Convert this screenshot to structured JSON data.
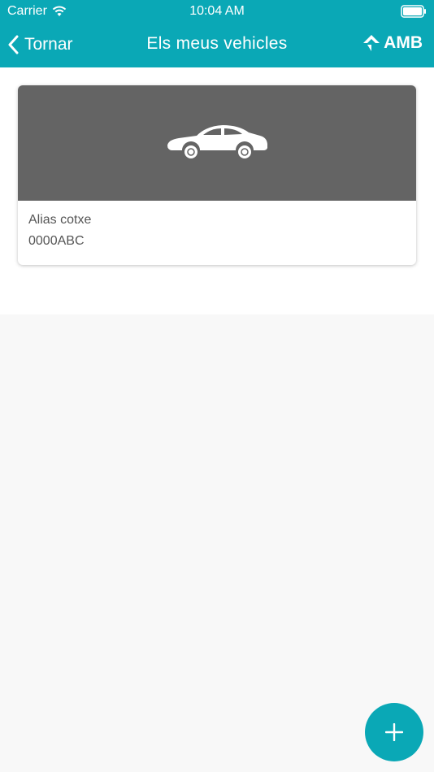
{
  "status_bar": {
    "carrier": "Carrier",
    "time": "10:04 AM"
  },
  "nav": {
    "back_label": "Tornar",
    "title": "Els meus vehicles",
    "logo_text": "AMB"
  },
  "vehicles": [
    {
      "alias": "Alias cotxe",
      "plate": "0000ABC",
      "icon": "car-icon"
    }
  ],
  "colors": {
    "accent": "#0aa8b6",
    "card_image_bg": "#646464",
    "background": "#f8f8f8"
  },
  "icons": {
    "back": "chevron-left-icon",
    "add": "plus-icon",
    "wifi": "wifi-icon",
    "battery": "battery-icon"
  }
}
